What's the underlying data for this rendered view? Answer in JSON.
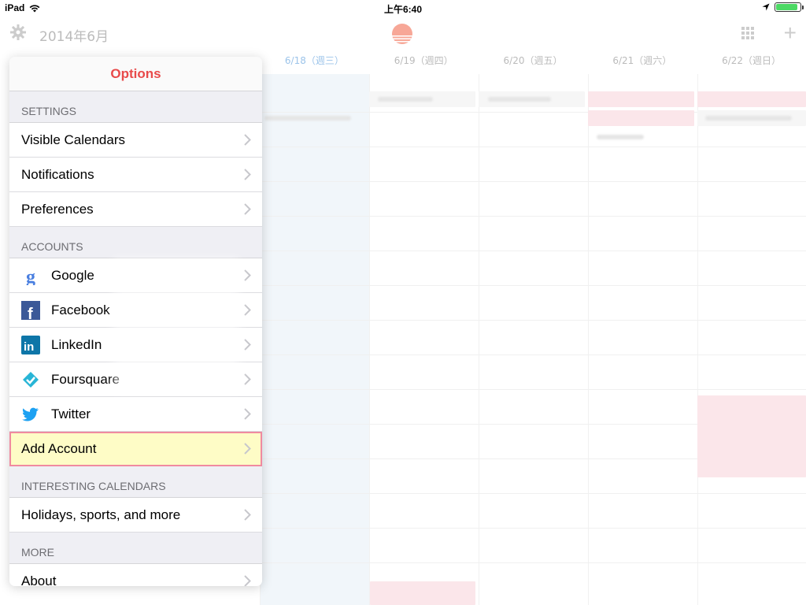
{
  "status_bar": {
    "device": "iPad",
    "time": "上午6:40",
    "battery_level": 0.9
  },
  "calendar": {
    "month_title": "2014年6月",
    "days": [
      {
        "label": "6/18（週三）",
        "today": true
      },
      {
        "label": "6/19（週四）",
        "today": false
      },
      {
        "label": "6/20（週五）",
        "today": false
      },
      {
        "label": "6/21（週六）",
        "today": false
      },
      {
        "label": "6/22（週日）",
        "today": false
      }
    ],
    "colors": {
      "today_header": "#9cc4ea",
      "today_bg": "#f1f6fa",
      "sun": "#f7a797"
    }
  },
  "options": {
    "title": "Options",
    "settings_header": "SETTINGS",
    "settings": [
      "Visible Calendars",
      "Notifications",
      "Preferences"
    ],
    "accounts_header": "ACCOUNTS",
    "accounts": [
      {
        "name": "Google",
        "icon": "google-icon"
      },
      {
        "name": "Facebook",
        "icon": "facebook-icon"
      },
      {
        "name": "LinkedIn",
        "icon": "linkedin-icon"
      },
      {
        "name": "Foursquare",
        "icon": "foursquare-icon"
      },
      {
        "name": "Twitter",
        "icon": "twitter-icon"
      }
    ],
    "add_account": "Add Account",
    "interesting_header": "INTERESTING CALENDARS",
    "interesting": [
      "Holidays, sports, and more"
    ],
    "more_header": "MORE",
    "more": [
      "About"
    ],
    "colors": {
      "title": "#e84a4a",
      "highlight_bg": "#fefcc6",
      "highlight_border": "#f08aa0"
    }
  }
}
